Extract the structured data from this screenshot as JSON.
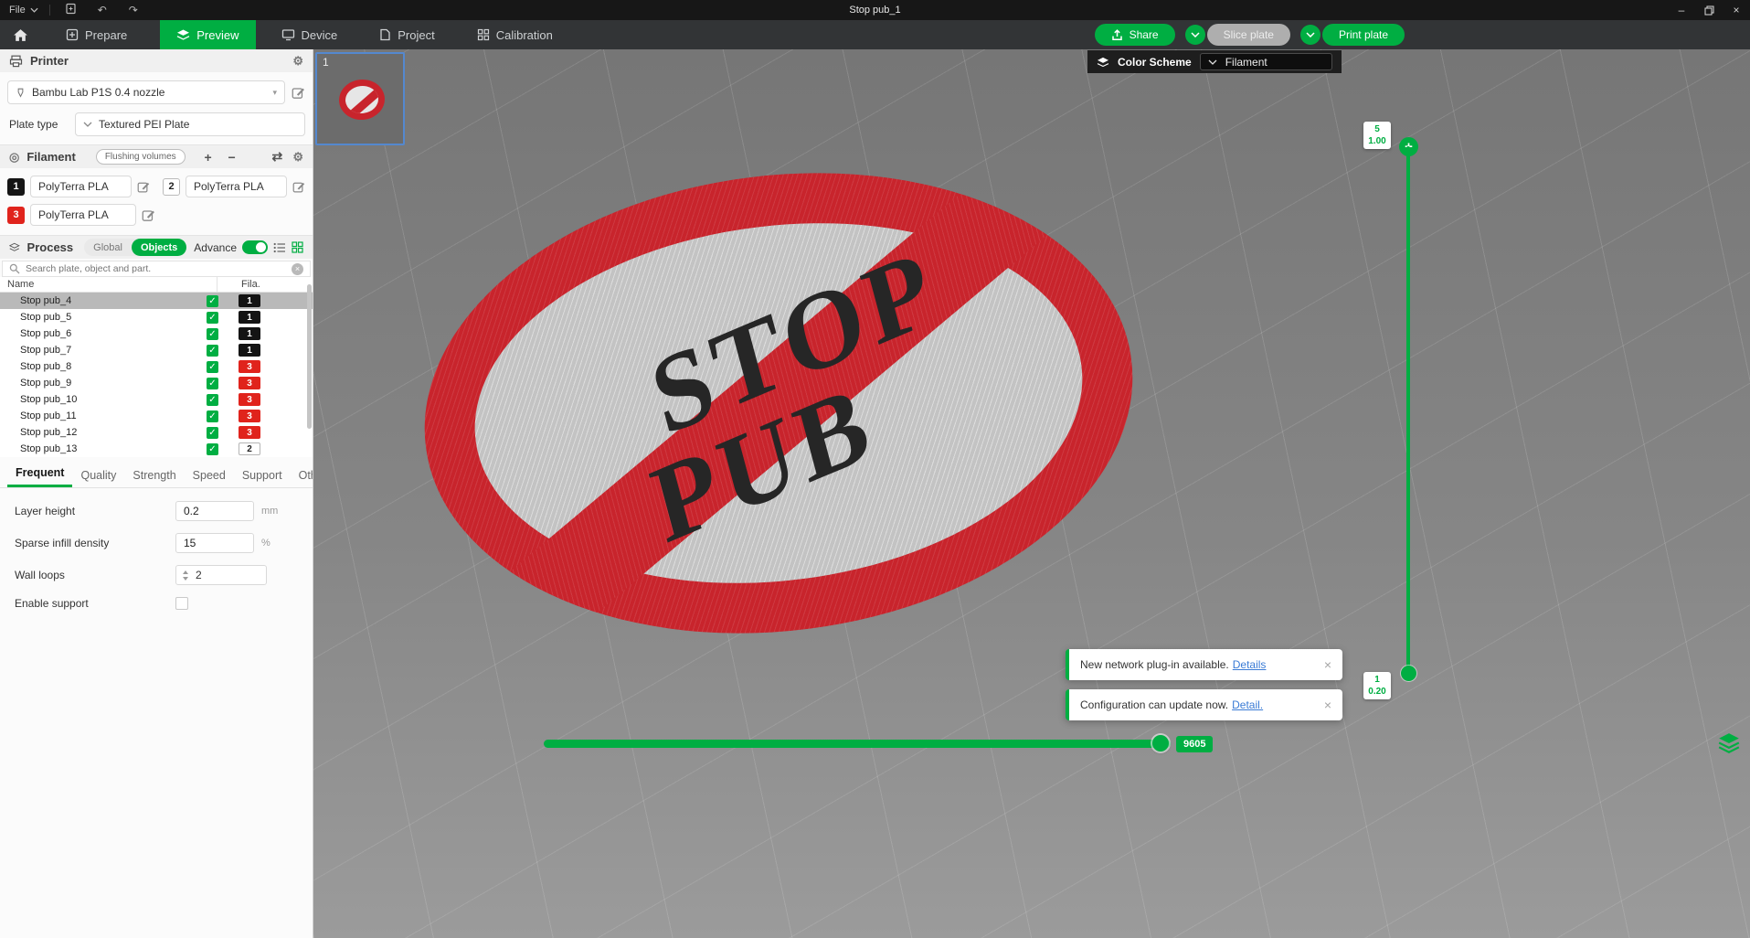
{
  "accent": "#00AE42",
  "icons": {
    "minimize": "–",
    "close": "×",
    "undo": "↶",
    "redo": "↷",
    "plus": "+",
    "minus": "−",
    "gear": "⚙",
    "spool": "◎",
    "sync": "⇄",
    "check": "✓",
    "caret": "▾",
    "clear": "×"
  },
  "titlebar": {
    "file_menu": "File",
    "title": "Stop pub_1"
  },
  "nav": {
    "tabs": [
      {
        "label": "Prepare"
      },
      {
        "label": "Preview"
      },
      {
        "label": "Device"
      },
      {
        "label": "Project"
      },
      {
        "label": "Calibration"
      }
    ],
    "share_label": "Share",
    "slice_label": "Slice plate",
    "print_label": "Print plate"
  },
  "printer": {
    "title": "Printer",
    "model": "Bambu Lab P1S 0.4 nozzle",
    "plate_type_label": "Plate type",
    "plate_type_value": "Textured PEI Plate"
  },
  "filament": {
    "title": "Filament",
    "flushing_label": "Flushing volumes",
    "slots": [
      {
        "id": "1",
        "name": "PolyTerra PLA",
        "color": "#141414",
        "text": "#ffffff"
      },
      {
        "id": "2",
        "name": "PolyTerra PLA",
        "color": "#ffffff",
        "text": "#222222"
      },
      {
        "id": "3",
        "name": "PolyTerra PLA",
        "color": "#e0231c",
        "text": "#ffffff"
      }
    ]
  },
  "process": {
    "title": "Process",
    "global_label": "Global",
    "objects_label": "Objects",
    "advance_label": "Advance",
    "search_placeholder": "Search plate, object and part.",
    "columns": {
      "name": "Name",
      "fila": "Fila."
    },
    "rows": [
      {
        "name": "Stop pub_4",
        "fila": "1",
        "bg": "#141414",
        "fg": "#ffffff"
      },
      {
        "name": "Stop pub_5",
        "fila": "1",
        "bg": "#141414",
        "fg": "#ffffff"
      },
      {
        "name": "Stop pub_6",
        "fila": "1",
        "bg": "#141414",
        "fg": "#ffffff"
      },
      {
        "name": "Stop pub_7",
        "fila": "1",
        "bg": "#141414",
        "fg": "#ffffff"
      },
      {
        "name": "Stop pub_8",
        "fila": "3",
        "bg": "#e0231c",
        "fg": "#ffffff"
      },
      {
        "name": "Stop pub_9",
        "fila": "3",
        "bg": "#e0231c",
        "fg": "#ffffff"
      },
      {
        "name": "Stop pub_10",
        "fila": "3",
        "bg": "#e0231c",
        "fg": "#ffffff"
      },
      {
        "name": "Stop pub_11",
        "fila": "3",
        "bg": "#e0231c",
        "fg": "#ffffff"
      },
      {
        "name": "Stop pub_12",
        "fila": "3",
        "bg": "#e0231c",
        "fg": "#ffffff"
      },
      {
        "name": "Stop pub_13",
        "fila": "2",
        "bg": "#ffffff",
        "fg": "#222222"
      }
    ]
  },
  "settings": {
    "tabs": [
      {
        "label": "Frequent"
      },
      {
        "label": "Quality"
      },
      {
        "label": "Strength"
      },
      {
        "label": "Speed"
      },
      {
        "label": "Support"
      },
      {
        "label": "Others"
      }
    ],
    "layer_height": {
      "label": "Layer height",
      "value": "0.2",
      "unit": "mm"
    },
    "sparse_infill": {
      "label": "Sparse infill density",
      "value": "15",
      "unit": "%"
    },
    "wall_loops": {
      "label": "Wall loops",
      "value": "2"
    },
    "enable_support": {
      "label": "Enable support"
    }
  },
  "viewport": {
    "plate_number": "1",
    "color_scheme_label": "Color Scheme",
    "color_scheme_value": "Filament",
    "sign": {
      "line1": "STOP",
      "line2": "PUB",
      "ring_color": "#c8242c",
      "face_color": "#c9c9c9",
      "text_color": "#262626"
    },
    "layer_slider": {
      "top_layer": "5",
      "top_height": "1.00",
      "bottom_layer": "1",
      "bottom_height": "0.20"
    },
    "progress_badge": "9605"
  },
  "notifications": [
    {
      "message": "New network plug-in available.",
      "link": "Details"
    },
    {
      "message": "Configuration can update now.",
      "link": "Detail."
    }
  ]
}
